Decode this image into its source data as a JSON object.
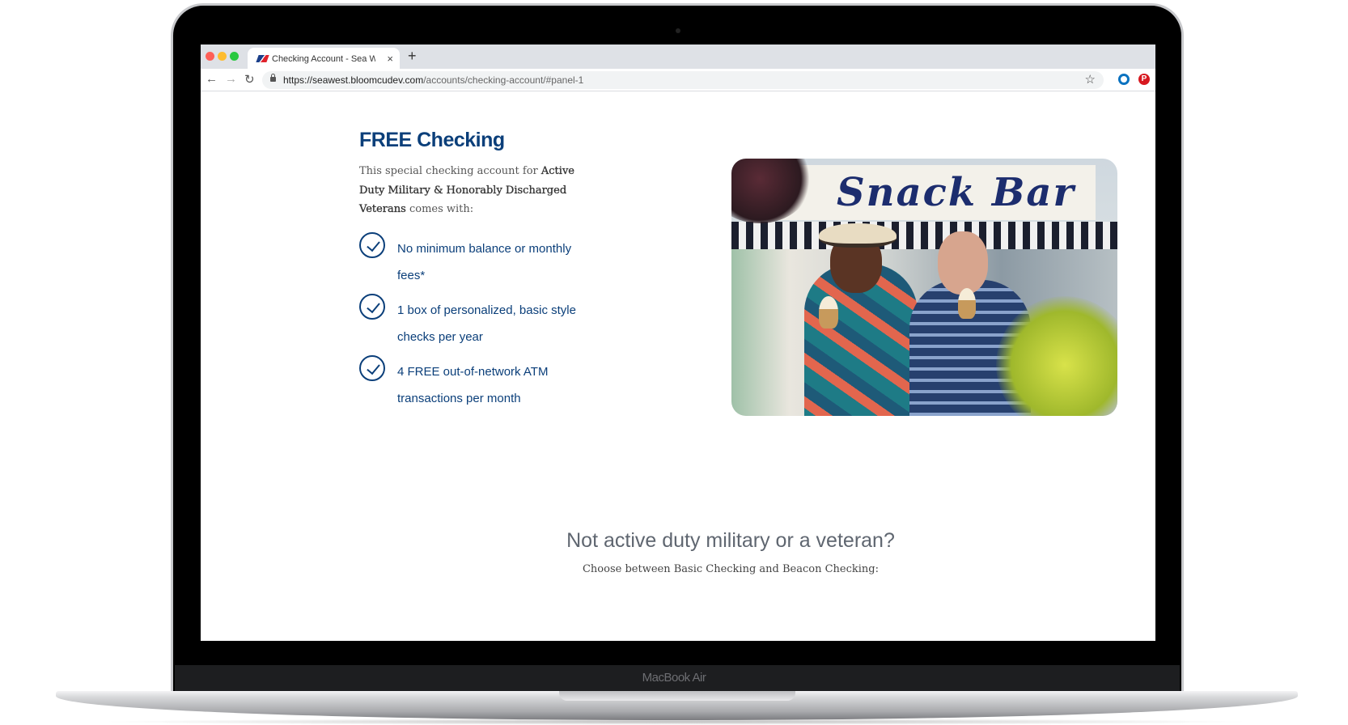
{
  "device": {
    "label": "MacBook Air"
  },
  "browser": {
    "tab_title": "Checking Account - Sea West Coast Guard FCU",
    "new_tab": "+",
    "close": "×",
    "url_host": "https://seawest.bloomcudev.com",
    "url_path": "/accounts/checking-account/#panel-1",
    "extensions": [
      "circle-extension-icon",
      "pinterest-icon"
    ],
    "colors": {
      "ext1": "#0a72c0",
      "pinterest": "#d7181f"
    }
  },
  "page": {
    "heading": "FREE Checking",
    "intro_plain": "This special checking account for ",
    "intro_bold": "Active Duty Military & Honorably Discharged Veterans",
    "intro_end": " comes with:",
    "benefits": [
      "No minimum balance or monthly fees*",
      "1 box of personalized, basic style checks per year",
      "4 FREE out-of-network ATM transactions per month"
    ],
    "photo": {
      "sign_text": "Snack Bar"
    },
    "not_military_title": "Not active duty military or a veteran?",
    "not_military_text": "Choose between Basic Checking and Beacon Checking:",
    "accent_color": "#0b3f7a"
  }
}
